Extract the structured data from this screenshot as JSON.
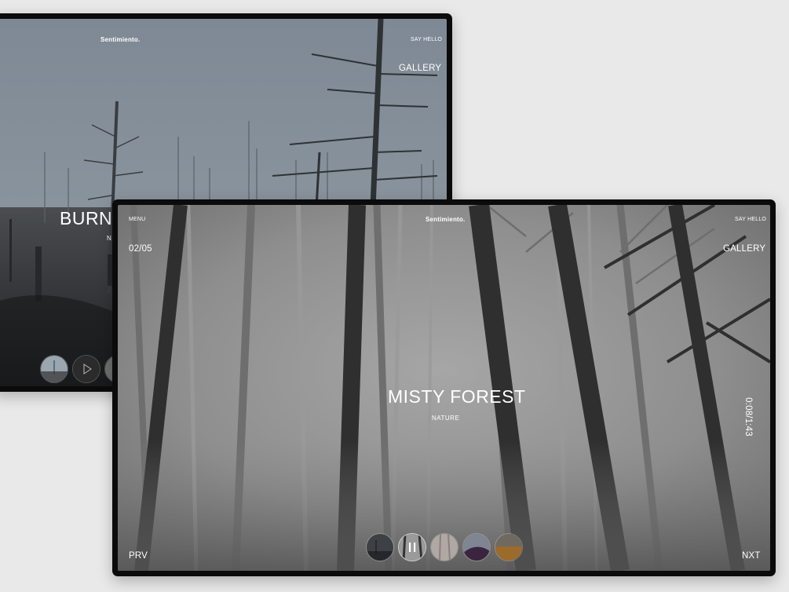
{
  "back_screen": {
    "brand": "Sentimiento.",
    "say_hello": "SAY HELLO",
    "gallery": "GALLERY",
    "title": "BURNT",
    "subtitle": "N"
  },
  "front_screen": {
    "menu": "MENU",
    "brand": "Sentimiento.",
    "say_hello": "SAY HELLO",
    "counter": "02/05",
    "gallery": "GALLERY",
    "title": "MISTY FOREST",
    "subtitle": "NATURE",
    "timer": "0:08/1:43",
    "prev": "PRV",
    "next": "NXT",
    "thumbnails": [
      "dark-forest",
      "misty-forest",
      "pale-forest",
      "purple-hill",
      "amber-field"
    ]
  }
}
